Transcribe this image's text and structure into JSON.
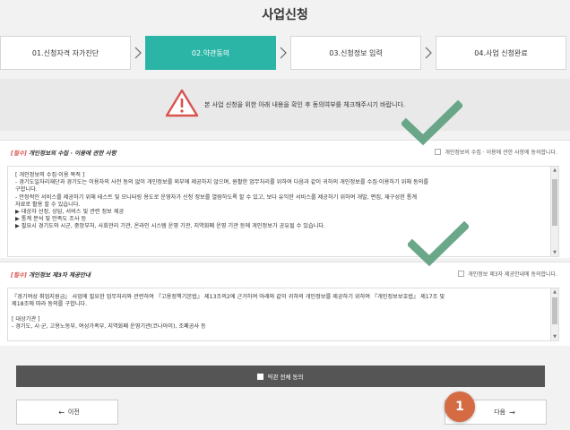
{
  "page": {
    "title": "사업신청"
  },
  "steps": [
    {
      "label": "01.신청자격 자가진단",
      "active": false
    },
    {
      "label": "02.약관동의",
      "active": true
    },
    {
      "label": "03.신청정보 입력",
      "active": false
    },
    {
      "label": "04.사업 신청완료",
      "active": false
    }
  ],
  "notice": {
    "text": "본 사업 신청을 위한 아래 내용을 확인 후 동의여부를 체크해주시기 바랍니다."
  },
  "section1": {
    "required_tag": "[필수]",
    "title": " 개인정보의 수집 · 이용에 관한 사항",
    "agree_label": "개인정보의 수집 · 이용에 관한 사항에 동의합니다.",
    "lines": [
      "[ 개인정보의 수집·이용 목적 ]",
      "- 경기도일자리재단과 경기도는 이용자의 사전 동의 없이 개인정보를 외부에 제공하지 않으며, 원활한 업무처리를 위하여 다음과 같이 귀하의 개인정보를 수집·이용하기 위해 동의를",
      "구합니다.",
      "- 안정적인 서비스를 제공하기 위해 테스트 및 모니터링 용도로 운영자가 신청 정보를 열람하도록 할 수 있고, 보다 유익한 서비스를 제공하기 위하여 개발, 편집, 재구성한 통계",
      "자료로 활용 할 수 있습니다.",
      "   ▶ 대상자 선정, 상담, 서비스 및 관련 정보 제공",
      "   ▶ 통계 분석 및 만족도 조사 등",
      "   ▶ 필요시 경기도와 시군, 중앙부처, 사회관리 기관, 온라인 시스템 운영 기관, 지역화폐 운영 기관 등에 개인정보가 공유될 수 있습니다."
    ]
  },
  "section2": {
    "required_tag": "[필수]",
    "title": " 개인정보 제3자 제공안내",
    "agree_label": "개인정보 제3자 제공안내에 동의합니다.",
    "lines": [
      "『경기여성 취업지원금』 사업에 필요한 업무처리와 관련하여 『고용정책기본법』 제13조의2에 근거하여 아래와 같이 귀하의 개인정보를 제공하기 위하여 『개인정보보호법』 제17조 및",
      "제18조에 따라 동의를 구합니다.",
      "",
      "[ 대상기관 ]",
      "- 경기도, 시·군, 고용노동부, 여성가족부, 지역화폐 운영기관(코나아이), 조폐공사 등"
    ]
  },
  "agree_all": {
    "label": "약관 전체 동의"
  },
  "nav": {
    "prev_label": "이전",
    "next_label": "다음",
    "prev_arrow": "←",
    "next_arrow": "→"
  },
  "annotation": {
    "badge_number": "1"
  },
  "colors": {
    "accent": "#2bb5a6",
    "check": "#5a9e7c",
    "badge": "#d46b43",
    "warning": "#d9534f"
  }
}
